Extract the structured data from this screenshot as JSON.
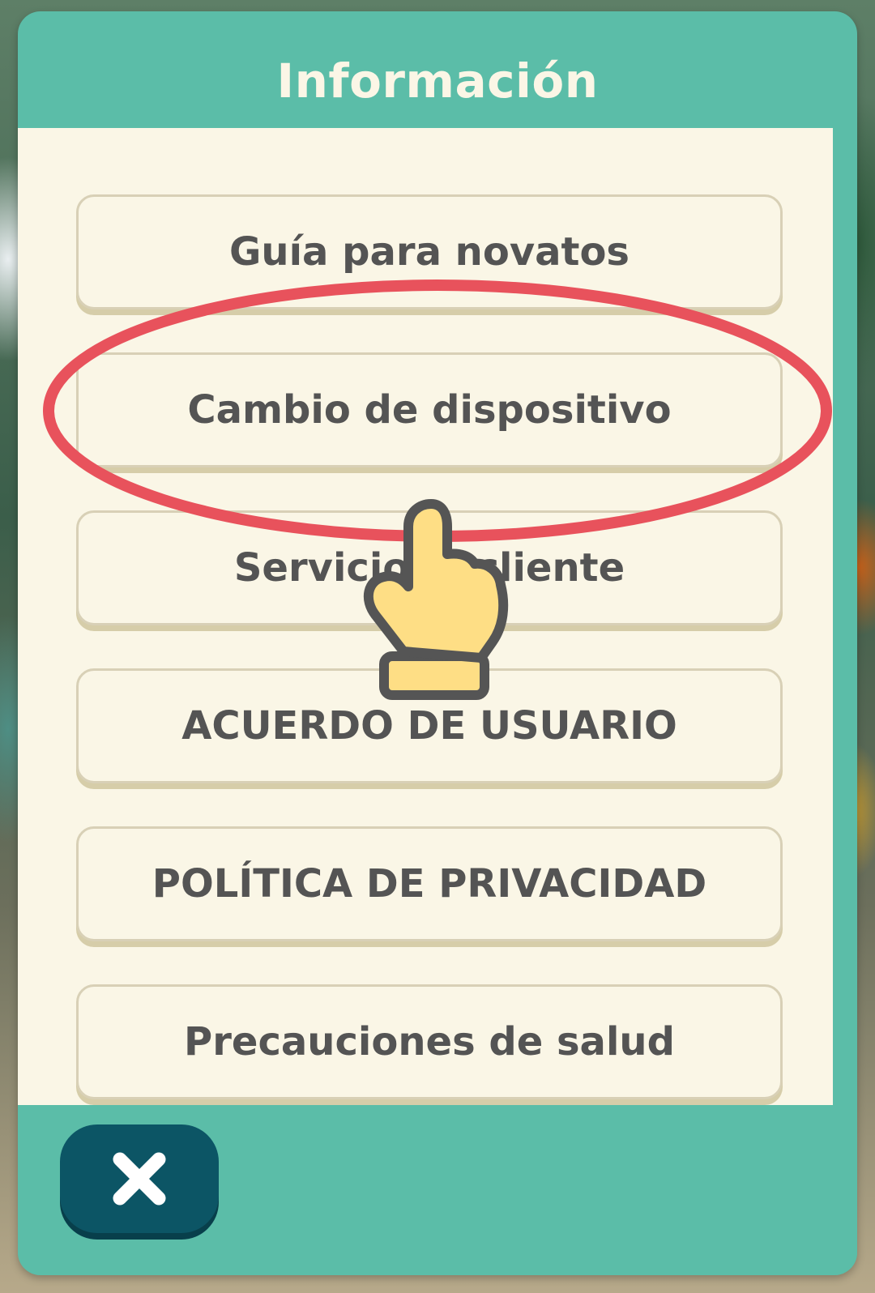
{
  "dialog": {
    "title": "Información",
    "menu_items": [
      {
        "label": "Guía para novatos"
      },
      {
        "label": "Cambio de dispositivo"
      },
      {
        "label": "Servicio al cliente"
      },
      {
        "label": "ACUERDO DE USUARIO"
      },
      {
        "label": "POLÍTICA DE PRIVACIDAD"
      },
      {
        "label": "Precauciones de salud"
      }
    ],
    "close_icon": "close-x-icon"
  },
  "annotation": {
    "highlight_color": "#e8525c",
    "pointer_icon": "hand-pointer-icon"
  },
  "colors": {
    "header": "#5bbda8",
    "panel": "#faf6e6",
    "button_text": "#545454",
    "close_button": "#0c5565"
  }
}
